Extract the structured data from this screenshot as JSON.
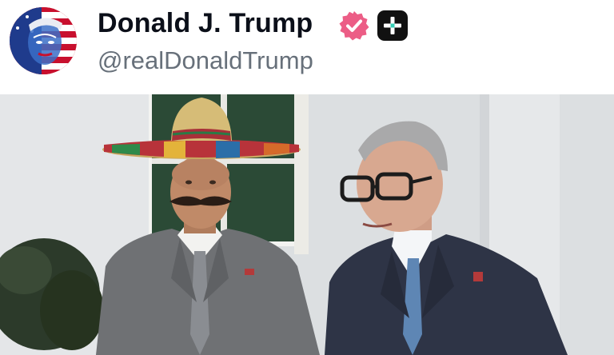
{
  "post": {
    "author_name": "Donald J. Trump",
    "author_handle": "@realDonaldTrump"
  },
  "icons": {
    "avatar": "american-flag-face-avatar",
    "verified": "verified-badge-icon",
    "plus": "plus-badge-icon"
  },
  "colors": {
    "verified_badge": "#ec5d86",
    "plus_badge": "#111111",
    "plus_cross": "#36d1b7",
    "name_text": "#0b0f19",
    "handle_text": "#67707a"
  }
}
